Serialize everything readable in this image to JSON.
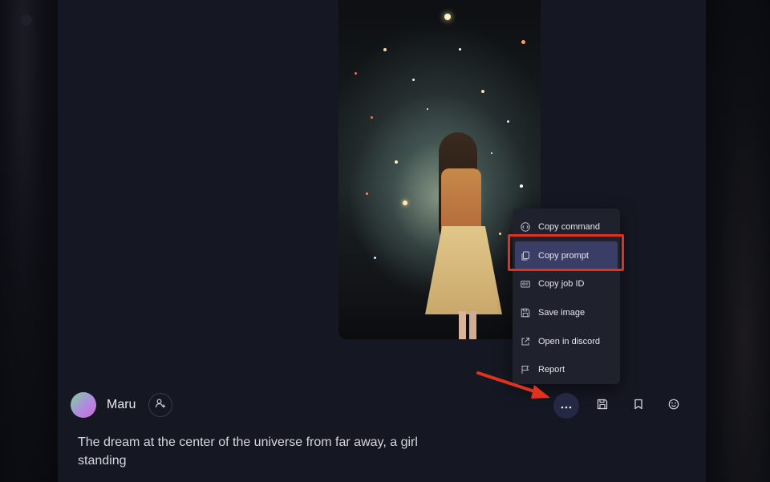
{
  "post": {
    "author": "Maru",
    "prompt": "The dream at the center of the universe from far away, a girl standing"
  },
  "menu": {
    "items": [
      {
        "label": "Copy command",
        "icon": "code-icon"
      },
      {
        "label": "Copy prompt",
        "icon": "copy-icon"
      },
      {
        "label": "Copy job ID",
        "icon": "id-card-icon"
      },
      {
        "label": "Save image",
        "icon": "floppy-disk-icon"
      },
      {
        "label": "Open in discord",
        "icon": "external-link-icon"
      },
      {
        "label": "Report",
        "icon": "flag-icon"
      }
    ],
    "active_index": 1
  },
  "actions": [
    {
      "name": "more-options",
      "icon": "ellipsis-icon"
    },
    {
      "name": "save",
      "icon": "floppy-disk-icon"
    },
    {
      "name": "bookmark",
      "icon": "bookmark-icon"
    },
    {
      "name": "react",
      "icon": "smiley-icon"
    }
  ],
  "colors": {
    "highlight": "#e0321c",
    "menu_active": "#3a3d66",
    "panel": "#151722"
  }
}
